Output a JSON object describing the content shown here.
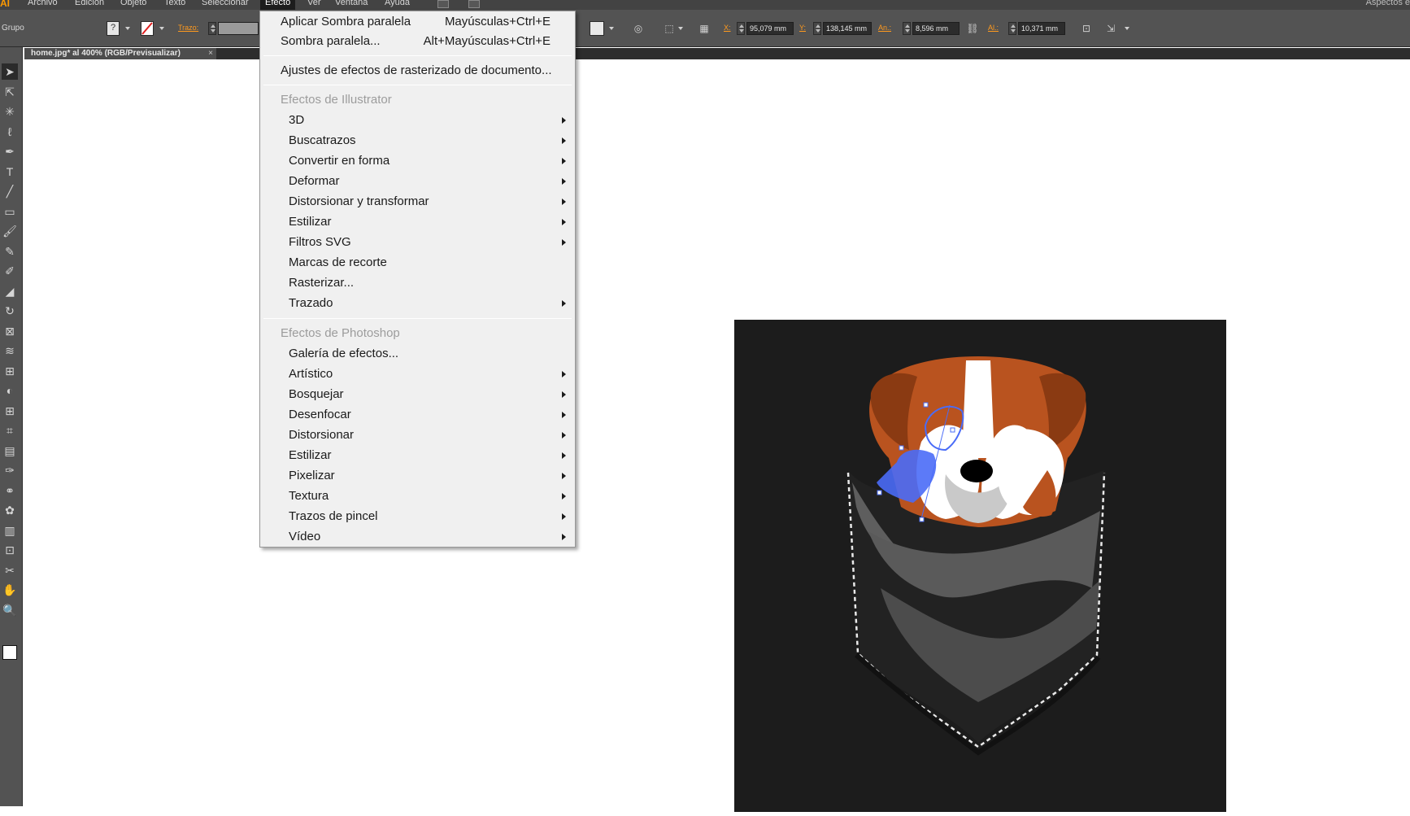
{
  "menubar": {
    "app_logo": "AI",
    "items": [
      "Archivo",
      "Edición",
      "Objeto",
      "Texto",
      "Seleccionar",
      "Efecto",
      "Ver",
      "Ventana",
      "Ayuda"
    ],
    "active": "Efecto",
    "workspace": "Aspectos e"
  },
  "controlbar": {
    "selection_type": "Grupo",
    "stroke_label": "Trazo:",
    "x_label": "X:",
    "x_value": "95,079 mm",
    "y_label": "Y:",
    "y_value": "138,145 mm",
    "width_label": "An.:",
    "width_value": "8,596 mm",
    "height_label": "Al.:",
    "height_value": "10,371 mm"
  },
  "document_tab": {
    "title": "home.jpg* al 400% (RGB/Previsualizar)",
    "close": "×"
  },
  "effect_menu": {
    "apply_last": {
      "label": "Aplicar Sombra paralela",
      "shortcut": "Mayúsculas+Ctrl+E"
    },
    "last_effect": {
      "label": "Sombra paralela...",
      "shortcut": "Alt+Mayúsculas+Ctrl+E"
    },
    "raster_settings": "Ajustes de efectos de rasterizado de documento...",
    "illustrator_header": "Efectos de Illustrator",
    "illustrator_items": [
      {
        "label": "3D",
        "submenu": true
      },
      {
        "label": "Buscatrazos",
        "submenu": true
      },
      {
        "label": "Convertir en forma",
        "submenu": true
      },
      {
        "label": "Deformar",
        "submenu": true
      },
      {
        "label": "Distorsionar y transformar",
        "submenu": true
      },
      {
        "label": "Estilizar",
        "submenu": true
      },
      {
        "label": "Filtros SVG",
        "submenu": true
      },
      {
        "label": "Marcas de recorte",
        "submenu": false
      },
      {
        "label": "Rasterizar...",
        "submenu": false
      },
      {
        "label": "Trazado",
        "submenu": true
      }
    ],
    "photoshop_header": "Efectos de Photoshop",
    "photoshop_items": [
      {
        "label": "Galería de efectos...",
        "submenu": false
      },
      {
        "label": "Artístico",
        "submenu": true
      },
      {
        "label": "Bosquejar",
        "submenu": true
      },
      {
        "label": "Desenfocar",
        "submenu": true
      },
      {
        "label": "Distorsionar",
        "submenu": true
      },
      {
        "label": "Estilizar",
        "submenu": true
      },
      {
        "label": "Pixelizar",
        "submenu": true
      },
      {
        "label": "Textura",
        "submenu": true
      },
      {
        "label": "Trazos de pincel",
        "submenu": true
      },
      {
        "label": "Vídeo",
        "submenu": true
      }
    ]
  },
  "colors": {
    "artboard": "#1c1c1c",
    "selection": "#4a6cf7",
    "dog_brown": "#b9531f",
    "pocket_gray": "#5e5e5e"
  },
  "icons": [
    "selection-tool-icon",
    "direct-selection-tool-icon",
    "magic-wand-icon",
    "lasso-icon",
    "pen-tool-icon",
    "type-tool-icon",
    "line-tool-icon",
    "rectangle-tool-icon",
    "paintbrush-icon",
    "pencil-icon",
    "blob-brush-icon",
    "eraser-icon",
    "rotate-tool-icon",
    "scale-tool-icon",
    "warp-tool-icon",
    "free-transform-icon",
    "shape-builder-icon",
    "perspective-grid-icon",
    "mesh-tool-icon",
    "gradient-tool-icon",
    "eyedropper-icon",
    "blend-tool-icon",
    "symbol-sprayer-icon",
    "column-graph-icon",
    "artboard-tool-icon",
    "slice-tool-icon",
    "hand-tool-icon",
    "zoom-tool-icon"
  ]
}
